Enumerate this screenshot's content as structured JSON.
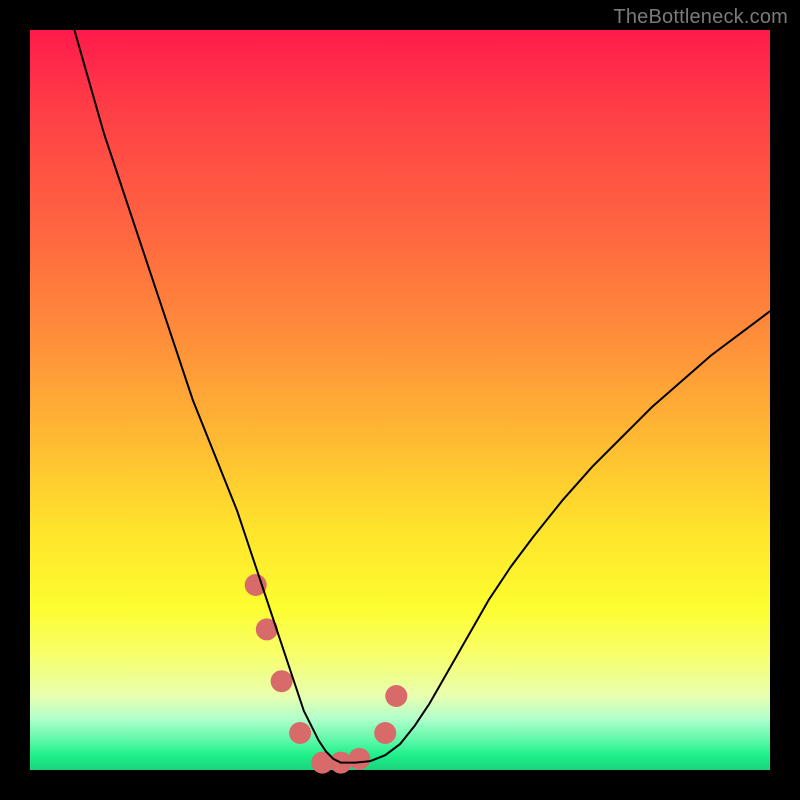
{
  "watermark": "TheBottleneck.com",
  "chart_data": {
    "type": "line",
    "title": "",
    "xlabel": "",
    "ylabel": "",
    "xlim": [
      0,
      100
    ],
    "ylim": [
      0,
      100
    ],
    "grid": false,
    "series": [
      {
        "name": "bottleneck-curve",
        "color": "#000000",
        "stroke_width": 2,
        "x": [
          6,
          8,
          10,
          12,
          14,
          16,
          18,
          20,
          22,
          24,
          26,
          28,
          29,
          30,
          31,
          32,
          33,
          34,
          35,
          36,
          37,
          38,
          39,
          40,
          41,
          42,
          44,
          46,
          48,
          50,
          52,
          54,
          56,
          58,
          60,
          62,
          65,
          68,
          72,
          76,
          80,
          84,
          88,
          92,
          96,
          100
        ],
        "y": [
          100,
          93,
          86,
          80,
          74,
          68,
          62,
          56,
          50,
          45,
          40,
          35,
          32,
          29,
          26,
          23,
          20,
          17,
          14,
          11,
          8,
          6,
          4,
          2.5,
          1.5,
          1,
          1,
          1.2,
          2,
          3.5,
          6,
          9,
          12.5,
          16,
          19.5,
          23,
          27.5,
          31.5,
          36.5,
          41,
          45,
          49,
          52.5,
          56,
          59,
          62
        ]
      },
      {
        "name": "highlight-markers",
        "color": "#d96a6a",
        "marker_size": 22,
        "x": [
          30.5,
          32,
          34,
          36.5,
          39.5,
          42,
          44.5,
          48,
          49.5
        ],
        "y": [
          25,
          19,
          12,
          5,
          1,
          1,
          1.5,
          5,
          10
        ]
      }
    ]
  },
  "colors": {
    "gradient_top": "#ff1a4b",
    "gradient_mid": "#ffe52c",
    "gradient_bottom": "#1bd47e",
    "curve": "#000000",
    "marker": "#d96a6a",
    "frame": "#000000",
    "watermark": "#7a7a7a"
  }
}
